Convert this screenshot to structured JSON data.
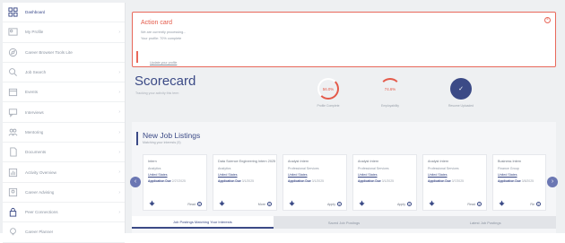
{
  "sidebar": {
    "items": [
      {
        "label": "Dashboard",
        "icon": "grid-icon",
        "active": true,
        "chevron": false
      },
      {
        "label": "My Profile",
        "icon": "id-card-icon",
        "chevron": true
      },
      {
        "label": "Career Browser Tools Lite",
        "icon": "compass-icon",
        "chevron": false
      },
      {
        "label": "Job Search",
        "icon": "search-icon",
        "chevron": true
      },
      {
        "label": "Events",
        "icon": "calendar-icon",
        "chevron": true
      },
      {
        "label": "Interviews",
        "icon": "chat-icon",
        "chevron": true
      },
      {
        "label": "Mentoring",
        "icon": "people-icon",
        "chevron": true
      },
      {
        "label": "Documents",
        "icon": "document-icon",
        "chevron": true
      },
      {
        "label": "Activity Overview",
        "icon": "chart-icon",
        "chevron": true
      },
      {
        "label": "Career Advising",
        "icon": "user-icon",
        "chevron": true
      },
      {
        "label": "Peer Connections",
        "icon": "lock-icon",
        "chevron": true
      },
      {
        "label": "Career Planner",
        "icon": "lightbulb-icon",
        "chevron": false
      }
    ]
  },
  "alert": {
    "title": "Action card",
    "line1": "We are currently processing...",
    "line2": "Your profile: 70% complete",
    "link": "Update your profile"
  },
  "scorecard": {
    "title": "Scorecard",
    "subtitle": "Tracking your activity this term",
    "gauges": [
      {
        "value": "56.0%",
        "caption": "Profile Complete"
      },
      {
        "value": "74.6%",
        "caption": "Employability"
      },
      {
        "value": "✓",
        "caption": "Resume Uploaded"
      }
    ]
  },
  "jobs": {
    "title": "New Job Listings",
    "subtitle": "Matching your interests (5)",
    "cards": [
      {
        "title": "Intern",
        "company": "Analytics",
        "location": "United States",
        "deadline_label": "Application Due",
        "deadline": "2/27/2025",
        "action": "Read"
      },
      {
        "title": "Data Science Engineering Intern 2025",
        "company": "Analytics",
        "location": "United States",
        "deadline_label": "Application Due",
        "deadline": "3/1/2025",
        "action": "More"
      },
      {
        "title": "Analyst Intern",
        "company": "Professional Services",
        "location": "United States",
        "deadline_label": "Application Due",
        "deadline": "3/1/2025",
        "action": "Apply"
      },
      {
        "title": "Analyst Intern",
        "company": "Professional Services",
        "location": "United States",
        "deadline_label": "Application Due",
        "deadline": "3/1/2025",
        "action": "Apply"
      },
      {
        "title": "Analyst Intern",
        "company": "Professional Services",
        "location": "United States",
        "deadline_label": "Application Due",
        "deadline": "3/7/2025",
        "action": "Read"
      },
      {
        "title": "Business Intern",
        "company": "Finance Group",
        "location": "United States",
        "deadline_label": "Application Due",
        "deadline": "3/8/2025",
        "action": "Re"
      }
    ],
    "tabs": [
      "Job Postings Matching Your Interests",
      "Saved Job Postings",
      "Latest Job Postings"
    ]
  },
  "colors": {
    "accent": "#3b4a86",
    "alert": "#e45a4a",
    "background": "#eef0f2"
  }
}
